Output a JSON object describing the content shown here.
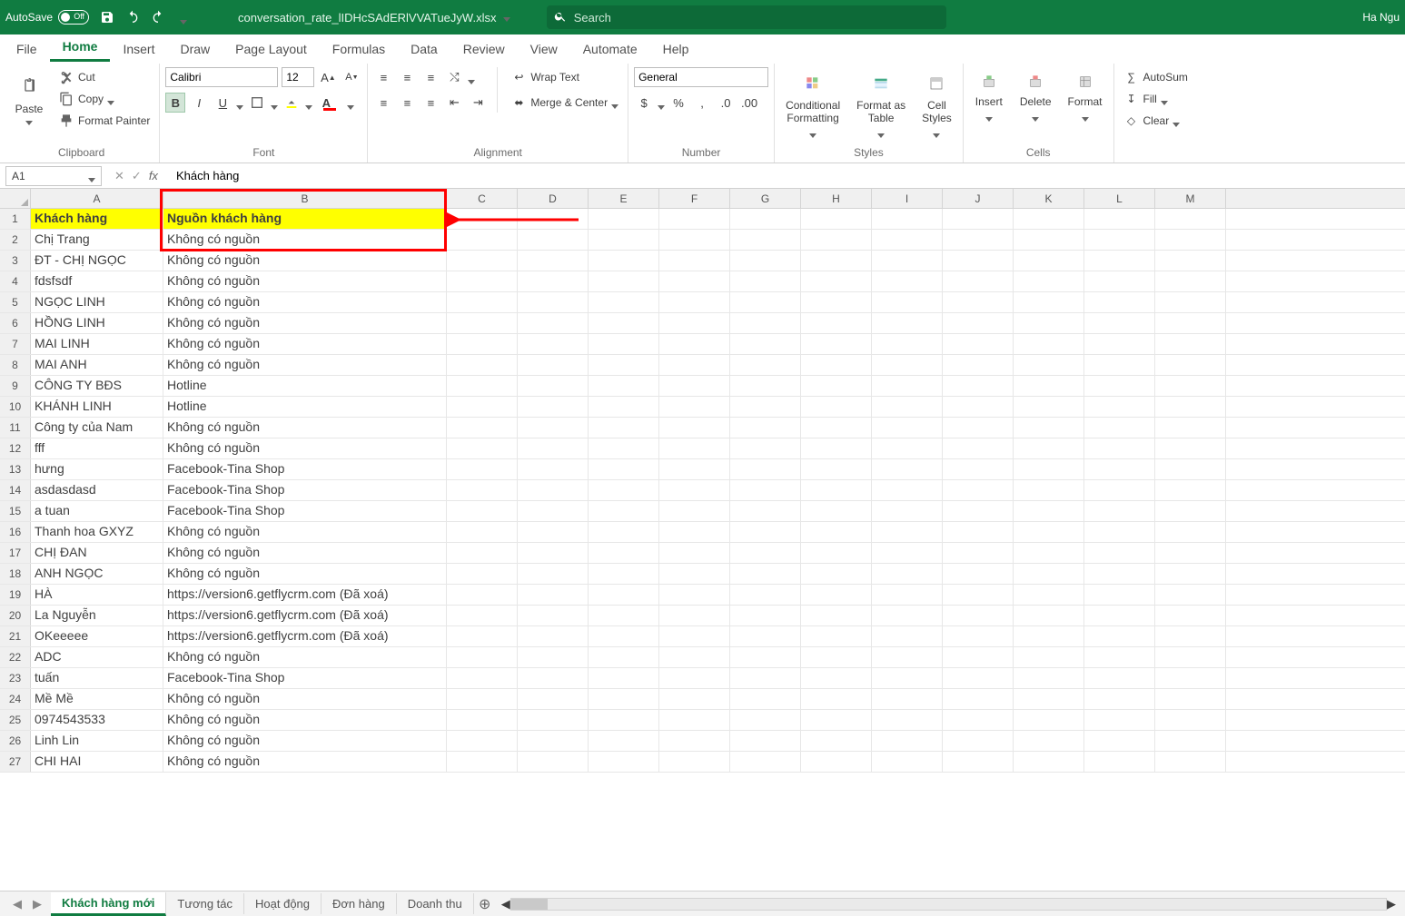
{
  "titlebar": {
    "autosave_label": "AutoSave",
    "filename": "conversation_rate_lIDHcSAdERlVVATueJyW.xlsx",
    "search_placeholder": "Search",
    "user": "Ha Ngu"
  },
  "ribbon": {
    "tabs": [
      "File",
      "Home",
      "Insert",
      "Draw",
      "Page Layout",
      "Formulas",
      "Data",
      "Review",
      "View",
      "Automate",
      "Help"
    ],
    "active_tab": "Home",
    "clipboard": {
      "paste": "Paste",
      "cut": "Cut",
      "copy": "Copy",
      "format_painter": "Format Painter",
      "label": "Clipboard"
    },
    "font": {
      "name": "Calibri",
      "size": "12",
      "label": "Font"
    },
    "alignment": {
      "wrap": "Wrap Text",
      "merge": "Merge & Center",
      "label": "Alignment"
    },
    "number": {
      "format": "General",
      "label": "Number"
    },
    "styles": {
      "cond": "Conditional\nFormatting",
      "table": "Format as\nTable",
      "cell": "Cell\nStyles",
      "label": "Styles"
    },
    "cells": {
      "insert": "Insert",
      "delete": "Delete",
      "format": "Format",
      "label": "Cells"
    },
    "editing": {
      "autosum": "AutoSum",
      "fill": "Fill",
      "clear": "Clear"
    }
  },
  "formula_bar": {
    "namebox": "A1",
    "formula": "Khách hàng"
  },
  "columns": [
    "A",
    "B",
    "C",
    "D",
    "E",
    "F",
    "G",
    "H",
    "I",
    "J",
    "K",
    "L",
    "M"
  ],
  "header_row": {
    "A": "Khách hàng",
    "B": "Nguồn khách hàng"
  },
  "rows": [
    {
      "A": "Chị Trang",
      "B": "Không có nguồn"
    },
    {
      "A": "ĐT - CHỊ NGỌC",
      "B": "Không có nguồn"
    },
    {
      "A": "fdsfsdf",
      "B": "Không có nguồn"
    },
    {
      "A": "NGỌC LINH",
      "B": "Không có nguồn"
    },
    {
      "A": "HỒNG LINH",
      "B": "Không có nguồn"
    },
    {
      "A": "MAI LINH",
      "B": "Không có nguồn"
    },
    {
      "A": "MAI ANH",
      "B": "Không có nguồn"
    },
    {
      "A": "CÔNG TY BĐS",
      "B": "Hotline"
    },
    {
      "A": "KHÁNH LINH",
      "B": "Hotline"
    },
    {
      "A": "Công ty của Nam",
      "B": "Không có nguồn"
    },
    {
      "A": "fff",
      "B": "Không có nguồn"
    },
    {
      "A": "hưng",
      "B": "Facebook-Tina Shop"
    },
    {
      "A": "asdasdasd",
      "B": "Facebook-Tina Shop"
    },
    {
      "A": "a tuan",
      "B": "Facebook-Tina Shop"
    },
    {
      "A": "Thanh hoa GXYZ",
      "B": "Không có nguồn"
    },
    {
      "A": "CHỊ ĐAN",
      "B": "Không có nguồn"
    },
    {
      "A": "ANH NGỌC",
      "B": "Không có nguồn"
    },
    {
      "A": "HÀ",
      "B": "https://version6.getflycrm.com (Đã xoá)"
    },
    {
      "A": "La Nguyễn",
      "B": "https://version6.getflycrm.com (Đã xoá)"
    },
    {
      "A": "OKeeeee",
      "B": "https://version6.getflycrm.com (Đã xoá)"
    },
    {
      "A": "ADC",
      "B": "Không có nguồn"
    },
    {
      "A": "tuấn",
      "B": "Facebook-Tina Shop"
    },
    {
      "A": "Mề Mề",
      "B": "Không có nguồn"
    },
    {
      "A": "0974543533",
      "B": "Không có nguồn"
    },
    {
      "A": "Linh Lin",
      "B": "Không có nguồn"
    },
    {
      "A": "CHI HAI",
      "B": "Không có nguồn"
    }
  ],
  "sheet_tabs": [
    "Khách hàng mới",
    "Tương tác",
    "Hoạt động",
    "Đơn hàng",
    "Doanh thu"
  ],
  "active_sheet": "Khách hàng mới"
}
